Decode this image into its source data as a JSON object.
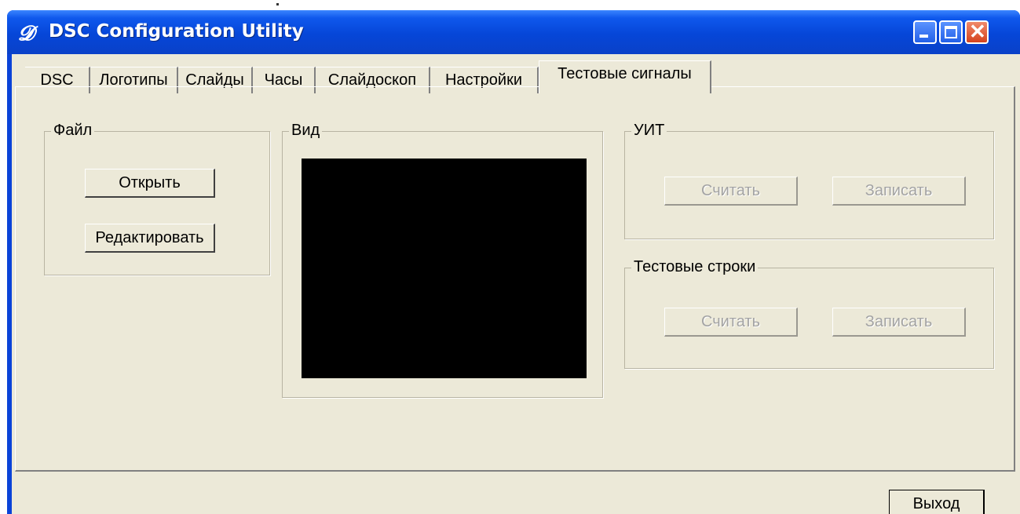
{
  "window": {
    "title": "DSC Configuration Utility",
    "icon": "app-logo-icon",
    "colors": {
      "titlebar": "#0a4fe0",
      "face": "#ece9d8",
      "close": "#d5421d"
    }
  },
  "tabs": [
    {
      "label": "DSC",
      "active": false
    },
    {
      "label": "Логотипы",
      "active": false
    },
    {
      "label": "Слайды",
      "active": false
    },
    {
      "label": "Часы",
      "active": false
    },
    {
      "label": "Слайдоскоп",
      "active": false
    },
    {
      "label": "Настройки",
      "active": false
    },
    {
      "label": "Тестовые сигналы",
      "active": true
    }
  ],
  "file_group": {
    "legend": "Файл",
    "open_label": "Открыть",
    "edit_label": "Редактировать"
  },
  "view_group": {
    "legend": "Вид"
  },
  "uit_group": {
    "legend": "УИТ",
    "read_label": "Считать",
    "write_label": "Записать"
  },
  "test_lines_group": {
    "legend": "Тестовые строки",
    "read_label": "Считать",
    "write_label": "Записать"
  },
  "footer": {
    "exit_label": "Выход"
  }
}
